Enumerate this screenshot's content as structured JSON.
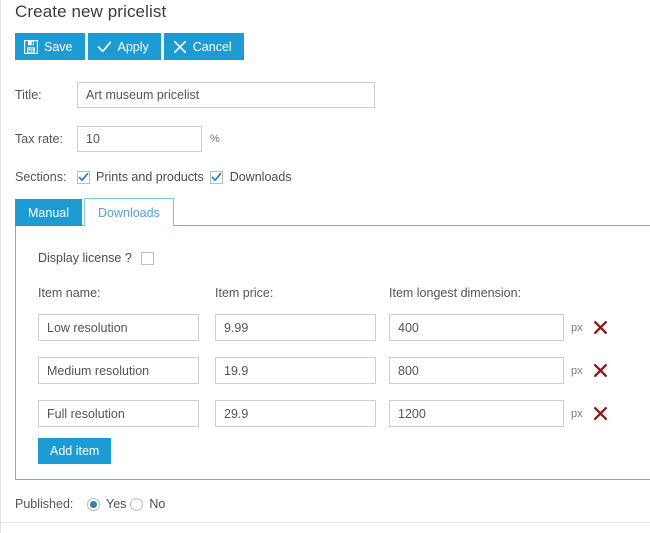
{
  "page": {
    "title": "Create new pricelist"
  },
  "colors": {
    "accent": "#1d9cd3",
    "tab_border": "#5fbde4",
    "delete": "#8c1b1b",
    "radio_dot": "#2f7fa8"
  },
  "toolbar": {
    "buttons": [
      {
        "label": "Save",
        "icon": "floppy-disk-icon"
      },
      {
        "label": "Apply",
        "icon": "check-icon"
      },
      {
        "label": "Cancel",
        "icon": "close-icon"
      }
    ]
  },
  "form": {
    "title_label": "Title:",
    "title_value": "Art museum pricelist",
    "title_placeholder": "",
    "tax_label": "Tax rate:",
    "tax_value": "10",
    "tax_placeholder": "",
    "tax_suffix": "%",
    "sections_label": "Sections:",
    "sections": [
      {
        "label": "Prints and products",
        "checked": true
      },
      {
        "label": "Downloads",
        "checked": true
      }
    ]
  },
  "tabs": {
    "items": [
      {
        "label": "Manual",
        "active": true
      },
      {
        "label": "Downloads",
        "active": false
      }
    ]
  },
  "panel": {
    "license_label": "Display license ?",
    "license_checked": false,
    "headers": {
      "name": "Item name:",
      "price": "Item price:",
      "dimension": "Item longest dimension:"
    },
    "unit": "px",
    "rows": [
      {
        "name": "Low resolution",
        "price": "9.99",
        "dimension": "400"
      },
      {
        "name": "Medium resolution",
        "price": "19.9",
        "dimension": "800"
      },
      {
        "name": "Full resolution",
        "price": "29.9",
        "dimension": "1200"
      }
    ],
    "add_label": "Add item"
  },
  "published": {
    "label": "Published:",
    "yes": "Yes",
    "no": "No",
    "selected": "Yes"
  }
}
